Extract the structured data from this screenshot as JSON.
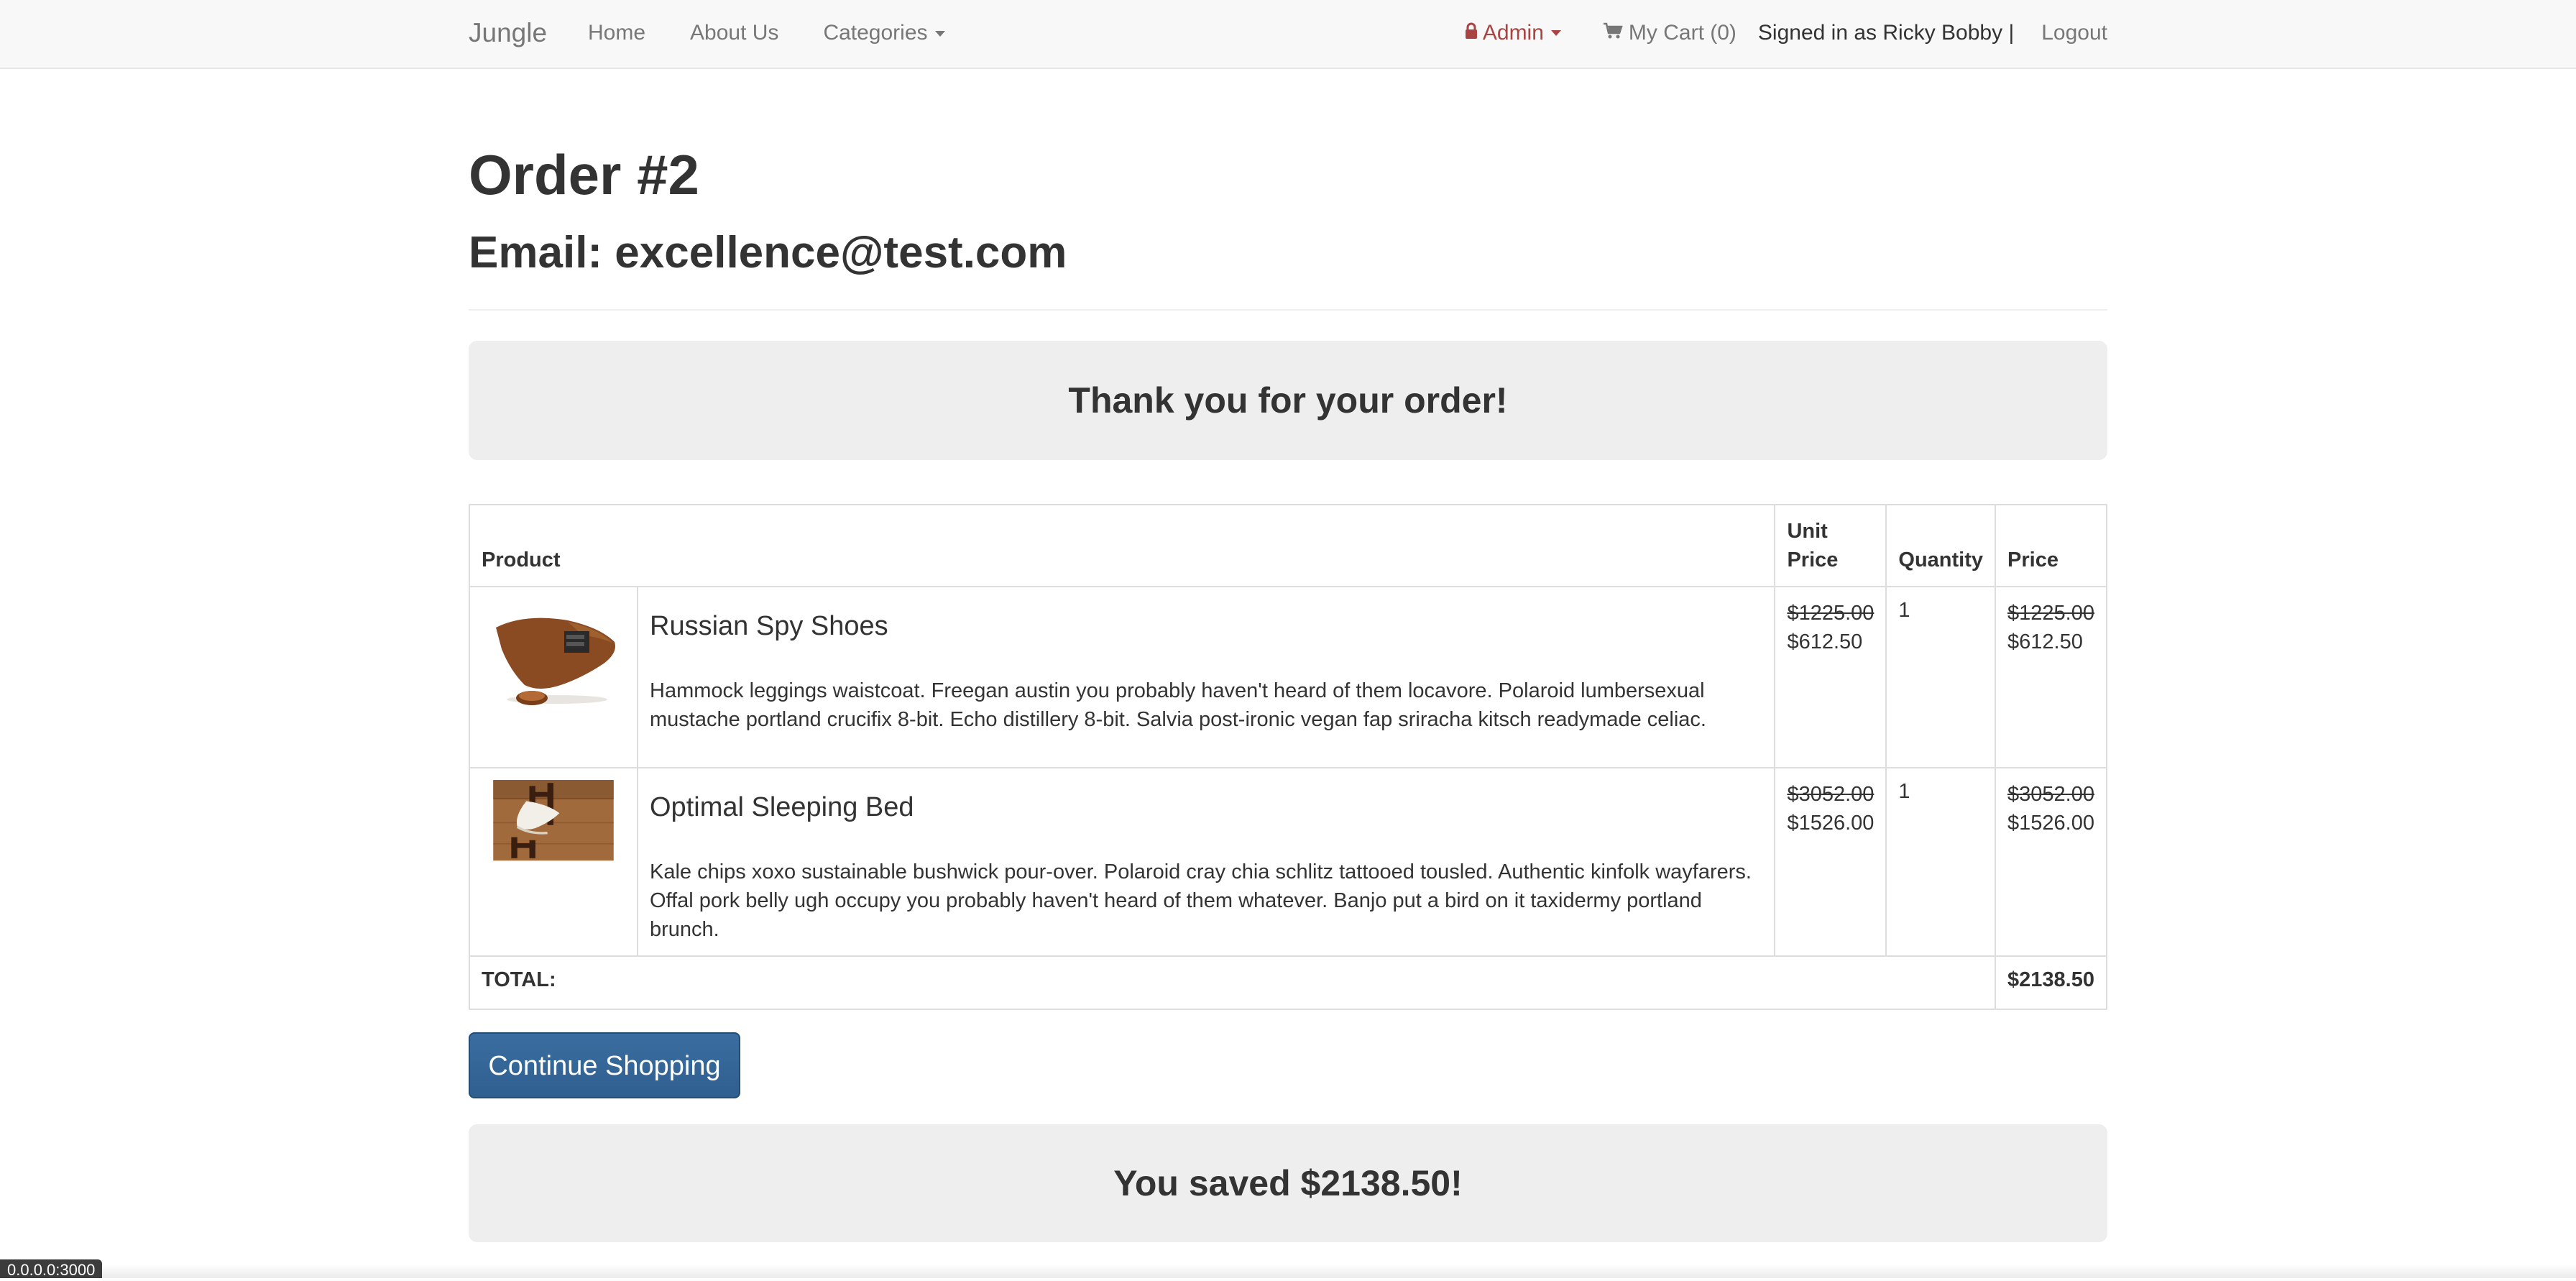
{
  "navbar": {
    "brand": "Jungle",
    "links": [
      "Home",
      "About Us"
    ],
    "categories_label": "Categories",
    "admin_label": "Admin",
    "cart_label": "My Cart (0)",
    "signed_in_text": "Signed in as Ricky Bobby |",
    "logout_label": "Logout",
    "colors": {
      "admin": "#a94442",
      "link": "#777777"
    },
    "icons": {
      "admin": "lock-icon",
      "cart": "cart-icon",
      "dropdown": "caret-down-icon"
    }
  },
  "order": {
    "title": "Order #2",
    "email_line": "Email: excellence@test.com",
    "thanks": "Thank you for your order!"
  },
  "table": {
    "headers": {
      "product": "Product",
      "unit_price": "Unit Price",
      "quantity": "Quantity",
      "price": "Price"
    },
    "items": [
      {
        "name": "Russian Spy Shoes",
        "description": "Hammock leggings waistcoat. Freegan austin you probably haven't heard of them locavore. Polaroid lumbersexual mustache portland crucifix 8-bit. Echo distillery 8-bit. Salvia post-ironic vegan fap sriracha kitsch readymade celiac.",
        "unit_price_original": "$1225.00",
        "unit_price": "$612.50",
        "quantity": "1",
        "price_original": "$1225.00",
        "price": "$612.50",
        "image": "shoe-image"
      },
      {
        "name": "Optimal Sleeping Bed",
        "description": "Kale chips xoxo sustainable bushwick pour-over. Polaroid cray chia schlitz tattooed tousled. Authentic kinfolk wayfarers. Offal pork belly ugh occupy you probably haven't heard of them whatever. Banjo put a bird on it taxidermy portland brunch.",
        "unit_price_original": "$3052.00",
        "unit_price": "$1526.00",
        "quantity": "1",
        "price_original": "$3052.00",
        "price": "$1526.00",
        "image": "bed-image"
      }
    ],
    "total_label": "TOTAL:",
    "total_value": "$2138.50"
  },
  "actions": {
    "continue_label": "Continue Shopping",
    "button_color": "#2f5f8f"
  },
  "savings": "You saved $2138.50!",
  "status_bar": "0.0.0.0:3000"
}
